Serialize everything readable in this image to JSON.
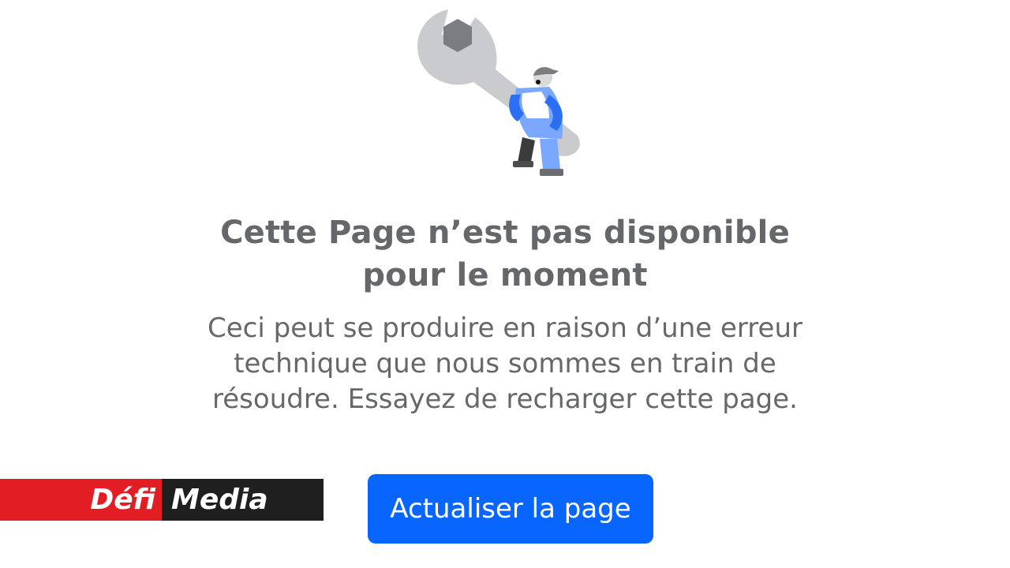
{
  "page": {
    "title": "Cette Page n’est pas disponible pour le moment",
    "subtitle": "Ceci peut se produire en raison d’une erreur technique que nous sommes en train de résoudre. Essayez de recharger cette page.",
    "refresh_button": "Actualiser la page"
  },
  "illustration": {
    "icon": "maintenance-worker-with-wrench-icon"
  },
  "watermark": {
    "part1": "Défi",
    "part2": "Media"
  },
  "colors": {
    "button_blue": "#0866ff",
    "text_gray": "#65676b",
    "wrench_gray": "#c9cbcf",
    "hex_gray": "#7b7d81",
    "worker_blue": "#3b82f6",
    "watermark_red": "#e21e24",
    "watermark_dark": "#1f1f1f"
  }
}
